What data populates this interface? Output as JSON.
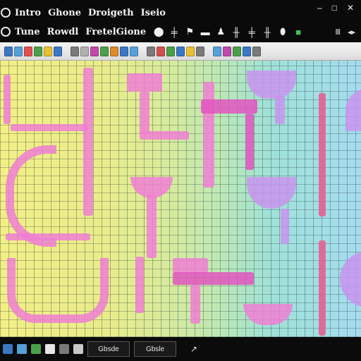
{
  "titlebar": {
    "title_words": [
      "Intro",
      "Ghone",
      "Droigeth",
      "Iseio"
    ],
    "ribbon_words": [
      "Tune",
      "Rowdl",
      "FretelGione"
    ]
  },
  "window_controls": [
    "–",
    "□",
    "✕"
  ],
  "ribbon_icons": [
    "settings-icon",
    "sliders-icon",
    "flag-icon",
    "dash-icon",
    "person-icon",
    "sliders-icon",
    "sliders-icon",
    "sliders-icon",
    "oval-icon",
    "green-square-icon"
  ],
  "ribbon_right": [
    "Ⅲ",
    "◂▸"
  ],
  "toolbar_colors": [
    "#3b78c4",
    "#56a0d8",
    "#e05050",
    "#4aa04a",
    "#e6c032",
    "#3b78c4",
    "#7a7a7a",
    "#b0b0b0",
    "#c04aa8",
    "#4aa04a",
    "#e08830",
    "#3b78c4",
    "#56a0d8",
    "#7a7a7a",
    "#d25050",
    "#4aa04a",
    "#3b78c4",
    "#e6c032",
    "#7a7a7a",
    "#56a0d8",
    "#c04aa8",
    "#4aa04a",
    "#3b78c4",
    "#7a7a7a"
  ],
  "taskbar": {
    "buttons": [
      "Gbsde",
      "Gbsle"
    ],
    "icon_colors": [
      "#3b78c4",
      "#56a0d8",
      "#4aa04a",
      "#e6e6e6",
      "#7a7a7a",
      "#c8c8c8"
    ],
    "arrow": "↗"
  }
}
